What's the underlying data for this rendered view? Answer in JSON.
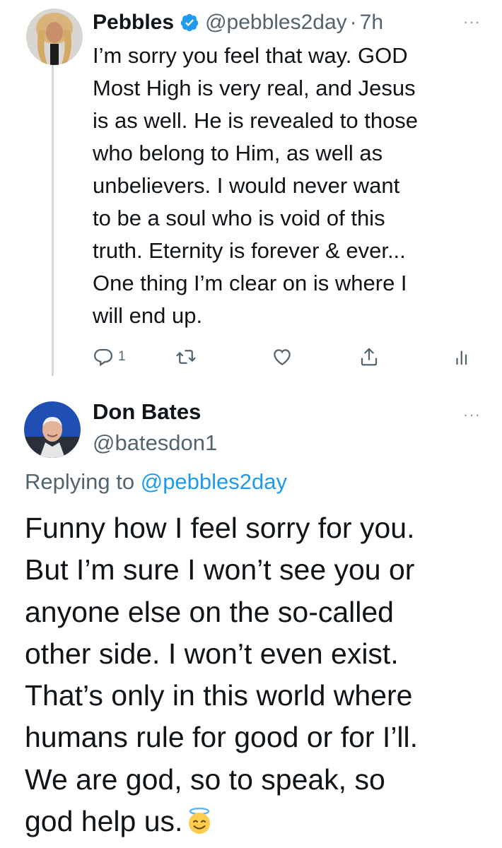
{
  "tweet1": {
    "display_name": "Pebbles",
    "handle": "@pebbles2day",
    "separator": "·",
    "time": "7h",
    "more": "···",
    "text": "I’m sorry you feel that way. GOD\nMost High is very real, and Jesus\nis as well. He is revealed to those\nwho belong to Him, as well as\nunbelievers. I would never want\nto be a soul who is void of this\ntruth. Eternity is forever & ever...\nOne thing I’m clear on is where I\nwill end up.",
    "reply_count": "1",
    "icons": [
      "reply-icon",
      "retweet-icon",
      "like-icon",
      "share-icon",
      "analytics-icon"
    ]
  },
  "tweet2": {
    "display_name": "Don Bates",
    "handle": "@batesdon1",
    "more": "···",
    "replying_label": "Replying to",
    "replying_to": "@pebbles2day",
    "text": "Funny how I feel sorry for you.\nBut I’m sure I won’t see you or\nanyone else on the so-called\nother side. I won’t even exist.\nThat’s only in this world where\nhumans rule for good or for I’ll.\nWe are god, so to speak, so\ngod help us.",
    "emoji": "smiling-face-with-halo"
  },
  "colors": {
    "accent": "#1d9bf0",
    "secondary_text": "#536471",
    "thread_line": "#cfd9de"
  }
}
